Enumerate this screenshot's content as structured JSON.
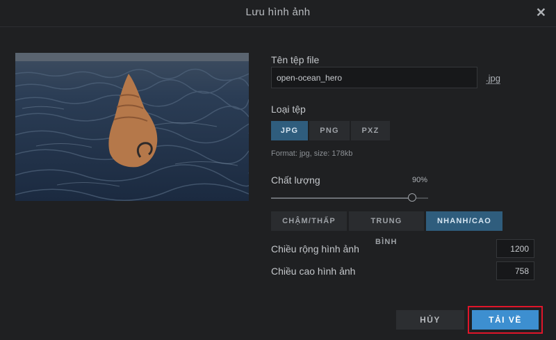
{
  "dialog": {
    "title": "Lưu hình ảnh",
    "close_icon": "close-icon"
  },
  "filename": {
    "label": "Tên tệp file",
    "value": "open-ocean_hero",
    "extension": ".jpg"
  },
  "filetype": {
    "label": "Loại tệp",
    "options": [
      "JPG",
      "PNG",
      "PXZ"
    ],
    "selected": "JPG",
    "info": "Format: jpg, size: 178kb"
  },
  "quality": {
    "label": "Chất lượng",
    "value_text": "90%",
    "value": 0.9,
    "presets": [
      "CHẬM/THẤP",
      "TRUNG",
      "NHANH/CAO"
    ],
    "preset_overflow": "BÌNH",
    "selected": "NHANH/CAO"
  },
  "dimensions": {
    "width_label": "Chiều rộng hình ảnh",
    "width_value": "1200",
    "height_label": "Chiều cao hình ảnh",
    "height_value": "758"
  },
  "actions": {
    "cancel_label": "HỦY",
    "download_label": "TẢI VỀ"
  },
  "colors": {
    "accent": "#3d8fd0",
    "active_segment": "#2f5d7d",
    "highlight": "#e0152a",
    "shell": "#b5784a"
  }
}
